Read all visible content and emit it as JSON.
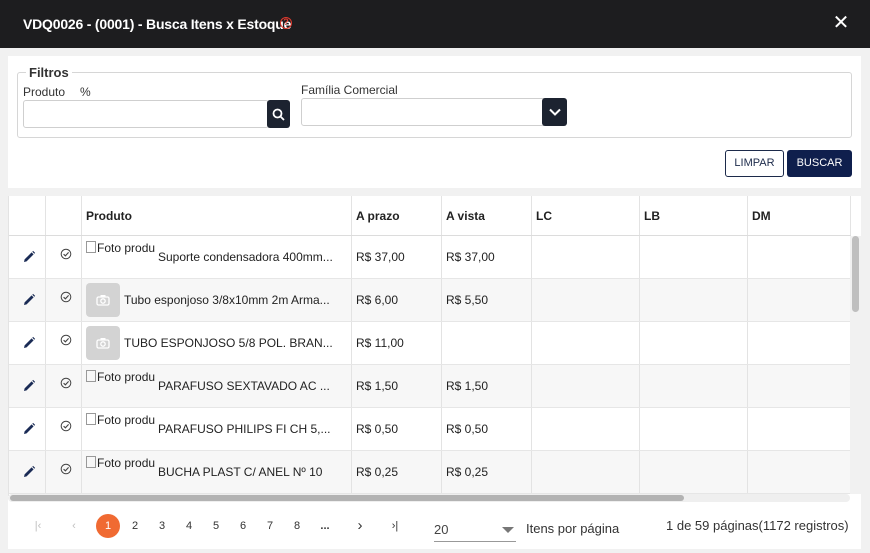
{
  "window": {
    "title": "VDQ0026 - (0001) - Busca Itens x Estoque",
    "help_glyph": "?",
    "close_glyph": "✕"
  },
  "filters": {
    "legend": "Filtros",
    "produto_label": "Produto",
    "produto_hint": "%",
    "produto_value": "",
    "familia_label": "Família Comercial",
    "familia_value": "",
    "clear_label": "LIMPAR",
    "search_label": "BUSCAR"
  },
  "table": {
    "columns": [
      "Produto",
      "A prazo",
      "A vista",
      "LC",
      "LB",
      "DM"
    ],
    "broken_image_alt": "Foto produ",
    "rows": [
      {
        "produto": "Suporte condensadora 400mm...",
        "a_prazo": "R$ 37,00",
        "a_vista": "R$ 37,00",
        "lc": "",
        "lb": "",
        "dm": "",
        "thumb": "broken"
      },
      {
        "produto": "Tubo esponjoso 3/8x10mm 2m Arma...",
        "a_prazo": "R$ 6,00",
        "a_vista": "R$ 5,50",
        "lc": "",
        "lb": "",
        "dm": "",
        "thumb": "camera"
      },
      {
        "produto": "TUBO ESPONJOSO 5/8 POL. BRAN...",
        "a_prazo": "R$ 11,00",
        "a_vista": "",
        "lc": "",
        "lb": "",
        "dm": "",
        "thumb": "camera"
      },
      {
        "produto": "PARAFUSO SEXTAVADO AC ...",
        "a_prazo": "R$ 1,50",
        "a_vista": "R$ 1,50",
        "lc": "",
        "lb": "",
        "dm": "",
        "thumb": "broken"
      },
      {
        "produto": "PARAFUSO PHILIPS FI CH 5,...",
        "a_prazo": "R$ 0,50",
        "a_vista": "R$ 0,50",
        "lc": "",
        "lb": "",
        "dm": "",
        "thumb": "broken"
      },
      {
        "produto": "BUCHA PLAST C/ ANEL Nº 10",
        "a_prazo": "R$ 0,25",
        "a_vista": "R$ 0,25",
        "lc": "",
        "lb": "",
        "dm": "",
        "thumb": "broken"
      }
    ]
  },
  "pagination": {
    "first_glyph": "|‹",
    "prev_glyph": "‹",
    "pages": [
      "1",
      "2",
      "3",
      "4",
      "5",
      "6",
      "7",
      "8"
    ],
    "active_page": "1",
    "ellipsis": "...",
    "next_glyph": "›",
    "last_glyph": "›|",
    "items_per_page": "20",
    "items_per_page_label": "Itens por página",
    "info": "1 de 59 páginas(1172 registros)"
  },
  "colors": {
    "titlebar": "#1d1d1f",
    "primary": "#0f1f4d",
    "active_page": "#f06a32",
    "help": "#e03a2e"
  }
}
